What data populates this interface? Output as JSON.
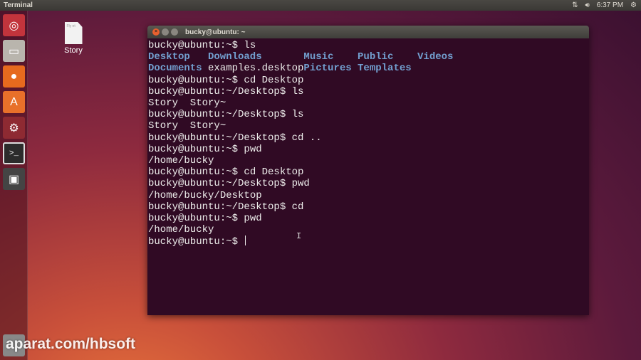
{
  "topbar": {
    "app": "Terminal",
    "time": "6:37 PM",
    "network_icon": "network-updown-icon",
    "volume_icon": "volume-icon",
    "power_icon": "gear-icon"
  },
  "launcher": [
    {
      "name": "ubuntu-dash",
      "glyph": "◎",
      "color": "#c2343c"
    },
    {
      "name": "files",
      "glyph": "▭",
      "color": "#b9b5ad"
    },
    {
      "name": "firefox",
      "glyph": "●",
      "color": "#e66a1e"
    },
    {
      "name": "software-center",
      "glyph": "A",
      "color": "#e8702a"
    },
    {
      "name": "system-settings",
      "glyph": "⚙",
      "color": "#8e2a32"
    },
    {
      "name": "terminal",
      "glyph": ">_",
      "color": "#2c2c2c"
    },
    {
      "name": "save",
      "glyph": "▣",
      "color": "#444"
    }
  ],
  "desktop": {
    "icon_label": "Story",
    "doc_text": "Fly nt"
  },
  "terminal": {
    "title": "bucky@ubuntu: ~",
    "ls_home": [
      [
        "Desktop",
        "Downloads",
        "Music",
        "Public",
        "Videos"
      ],
      [
        "Documents",
        "examples.desktop",
        "Pictures",
        "Templates",
        ""
      ]
    ],
    "ls_home_types": [
      [
        "dir",
        "dir",
        "dir",
        "dir",
        "dir"
      ],
      [
        "dir",
        "file",
        "dir",
        "dir",
        ""
      ]
    ],
    "lines_before": [
      "bucky@ubuntu:~$ ls"
    ],
    "lines_after": [
      "bucky@ubuntu:~$ cd Desktop",
      "bucky@ubuntu:~/Desktop$ ls",
      "Story  Story~",
      "bucky@ubuntu:~/Desktop$ ls",
      "Story  Story~",
      "bucky@ubuntu:~/Desktop$ cd ..",
      "bucky@ubuntu:~$ pwd",
      "/home/bucky",
      "bucky@ubuntu:~$ cd Desktop",
      "bucky@ubuntu:~/Desktop$ pwd",
      "/home/bucky/Desktop",
      "bucky@ubuntu:~/Desktop$ cd",
      "bucky@ubuntu:~$ pwd",
      "/home/bucky"
    ],
    "prompt": "bucky@ubuntu:~$ "
  },
  "watermark": "aparat.com/hbsoft"
}
